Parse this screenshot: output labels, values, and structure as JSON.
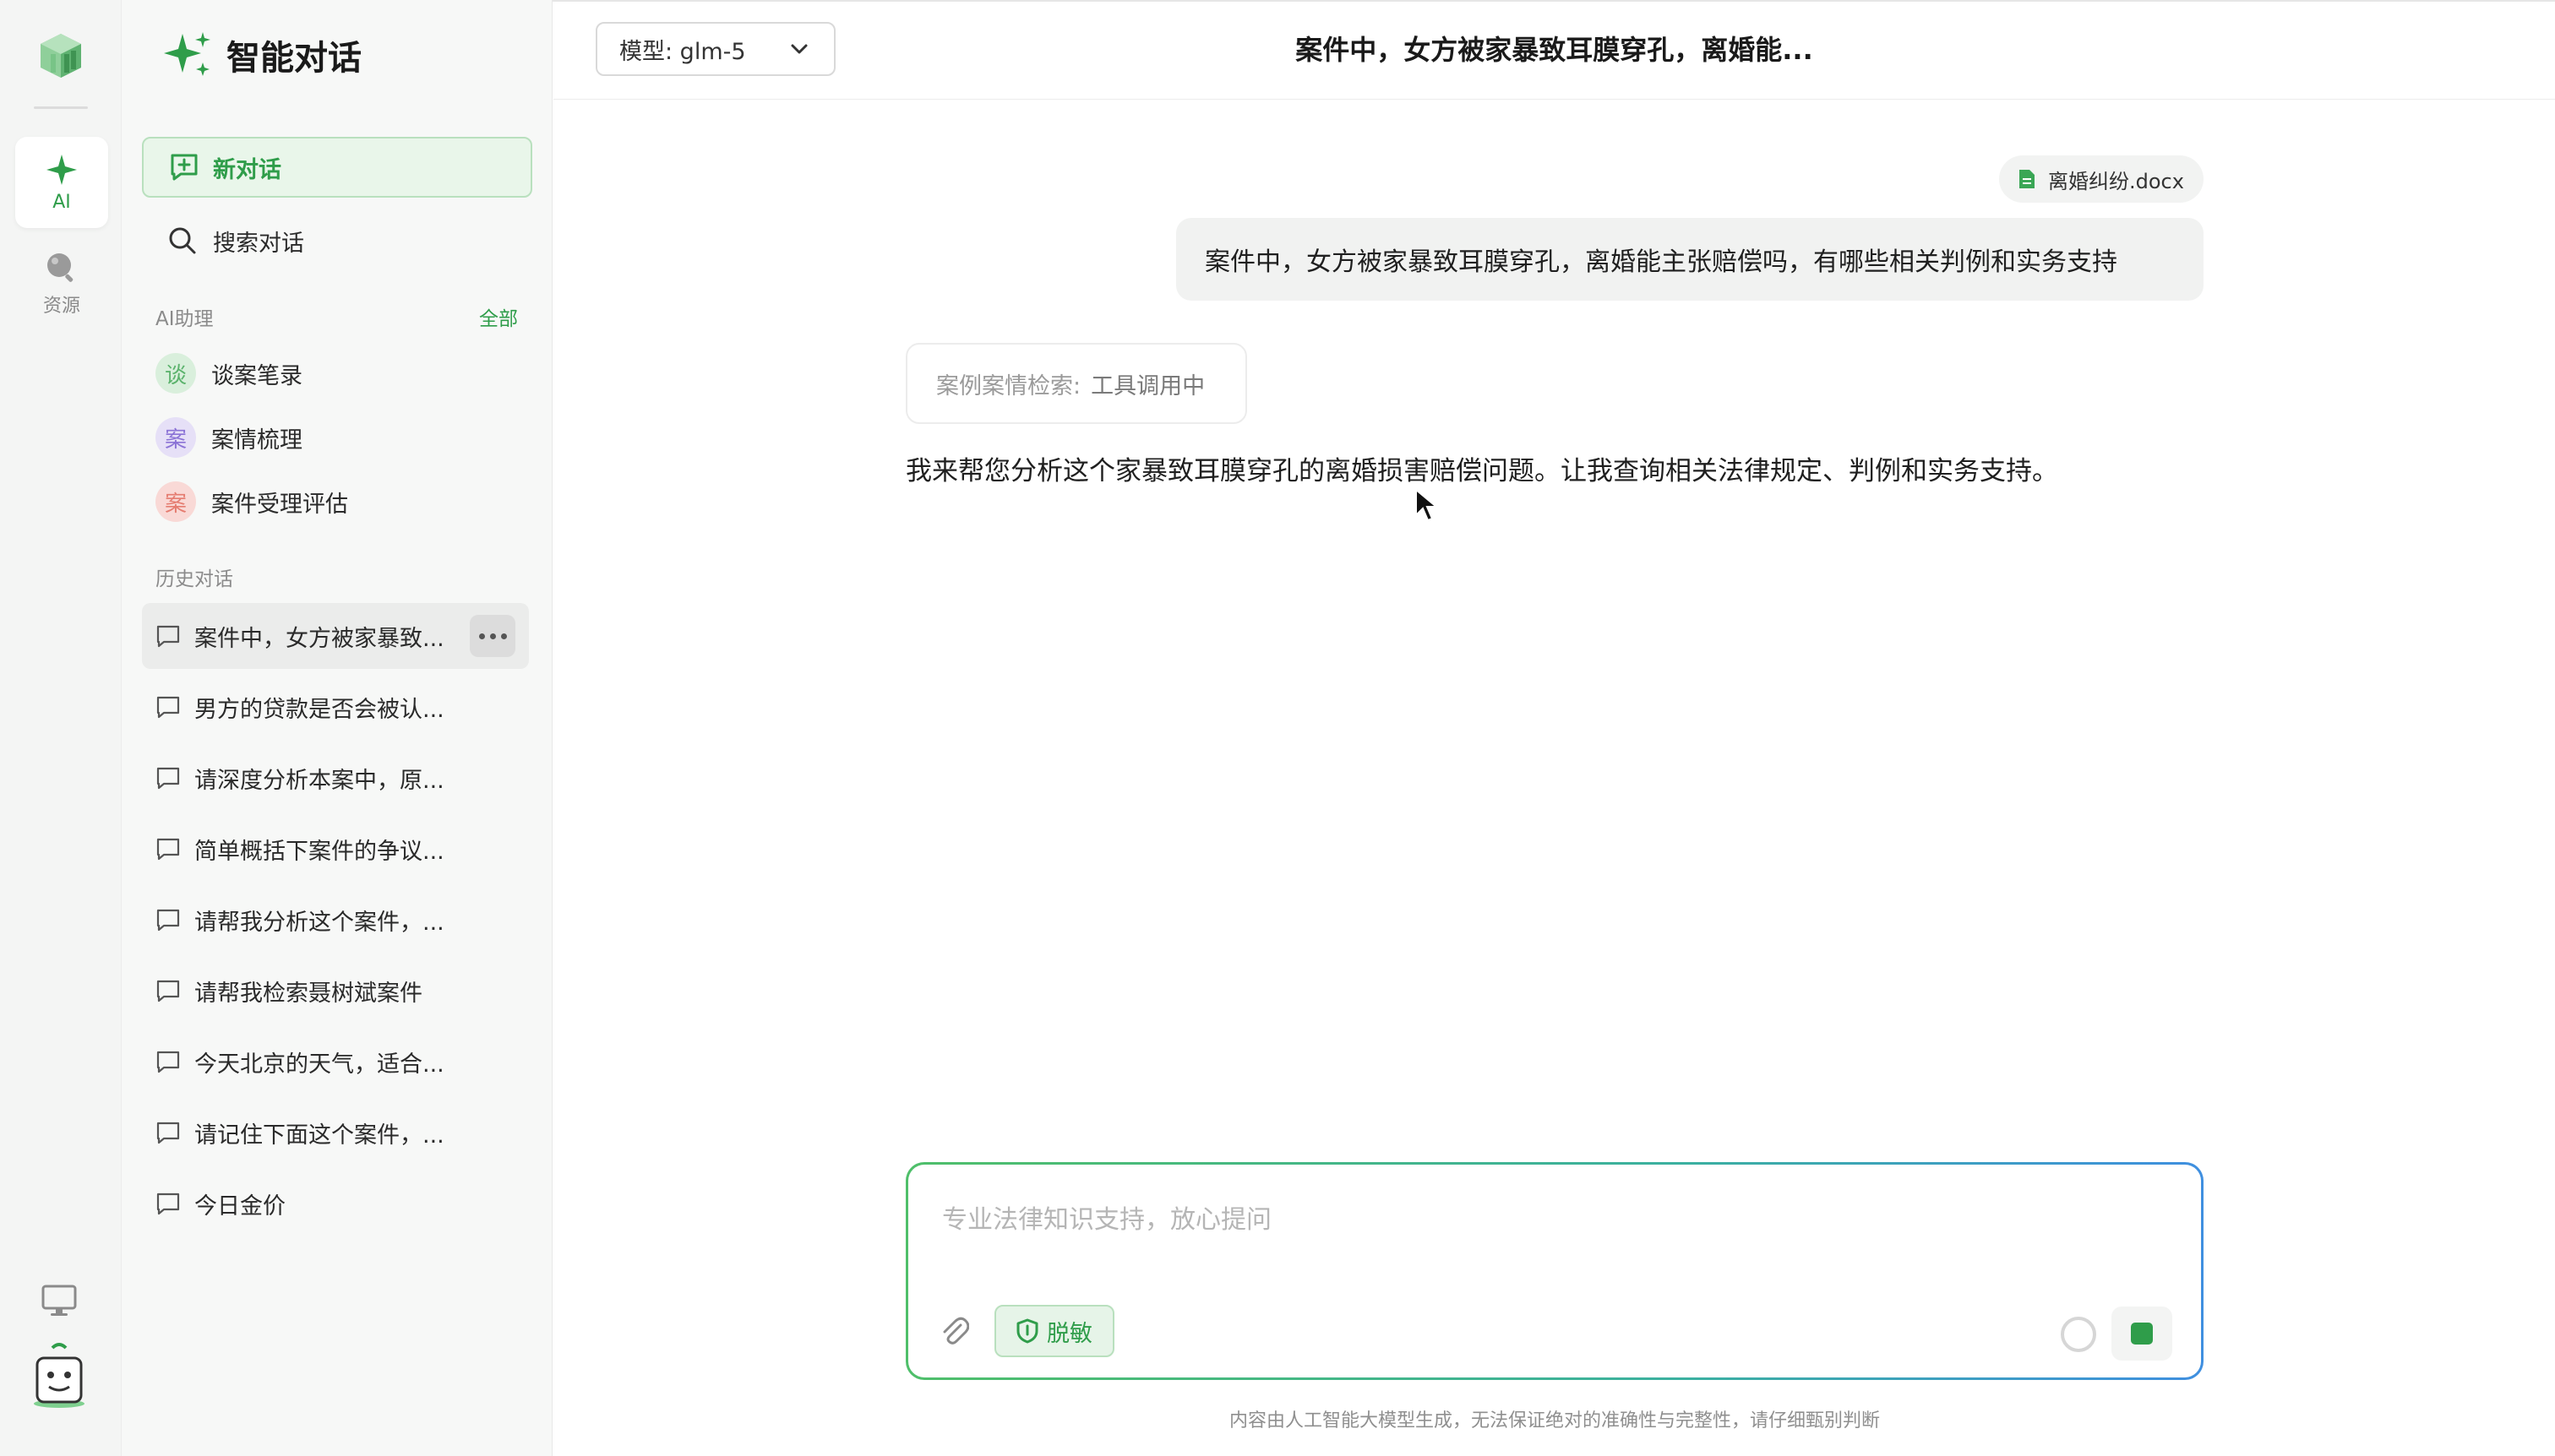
{
  "sidebar": {
    "title": "智能对话",
    "new_chat": "新对话",
    "search": "搜索对话",
    "assistants_label": "AI助理",
    "assistants_all": "全部",
    "assistants": [
      {
        "badge": "谈",
        "label": "谈案笔录",
        "bg": "#d9efdc",
        "fg": "#5cb36d"
      },
      {
        "badge": "案",
        "label": "案情梳理",
        "bg": "#e6e0f7",
        "fg": "#8b73d6"
      },
      {
        "badge": "案",
        "label": "案件受理评估",
        "bg": "#f9d9d6",
        "fg": "#e57c70"
      }
    ],
    "history_label": "历史对话",
    "history": [
      "案件中，女方被家暴致...",
      "男方的贷款是否会被认...",
      "请深度分析本案中，原...",
      "简单概括下案件的争议...",
      "请帮我分析这个案件，...",
      "请帮我检索聂树斌案件",
      "今天北京的天气，适合...",
      "请记住下面这个案件，...",
      "今日金价"
    ]
  },
  "rail": {
    "ai_label": "AI",
    "resources_label": "资源"
  },
  "topbar": {
    "model": "模型: glm-5",
    "title": "案件中，女方被家暴致耳膜穿孔，离婚能..."
  },
  "chat": {
    "file_name": "离婚纠纷.docx",
    "user_message": "案件中，女方被家暴致耳膜穿孔，离婚能主张赔偿吗，有哪些相关判例和实务支持",
    "tool_key": "案例案情检索:",
    "tool_value": "工具调用中",
    "assistant_message": "我来帮您分析这个家暴致耳膜穿孔的离婚损害赔偿问题。让我查询相关法律规定、判例和实务支持。"
  },
  "input": {
    "placeholder": "专业法律知识支持，放心提问",
    "desensitize": "脱敏"
  },
  "footer": {
    "disclaimer": "内容由人工智能大模型生成，无法保证绝对的准确性与完整性，请仔细甄别判断"
  },
  "colors": {
    "accent": "#2f9d4a",
    "accent_bg": "#e9f6ea"
  }
}
